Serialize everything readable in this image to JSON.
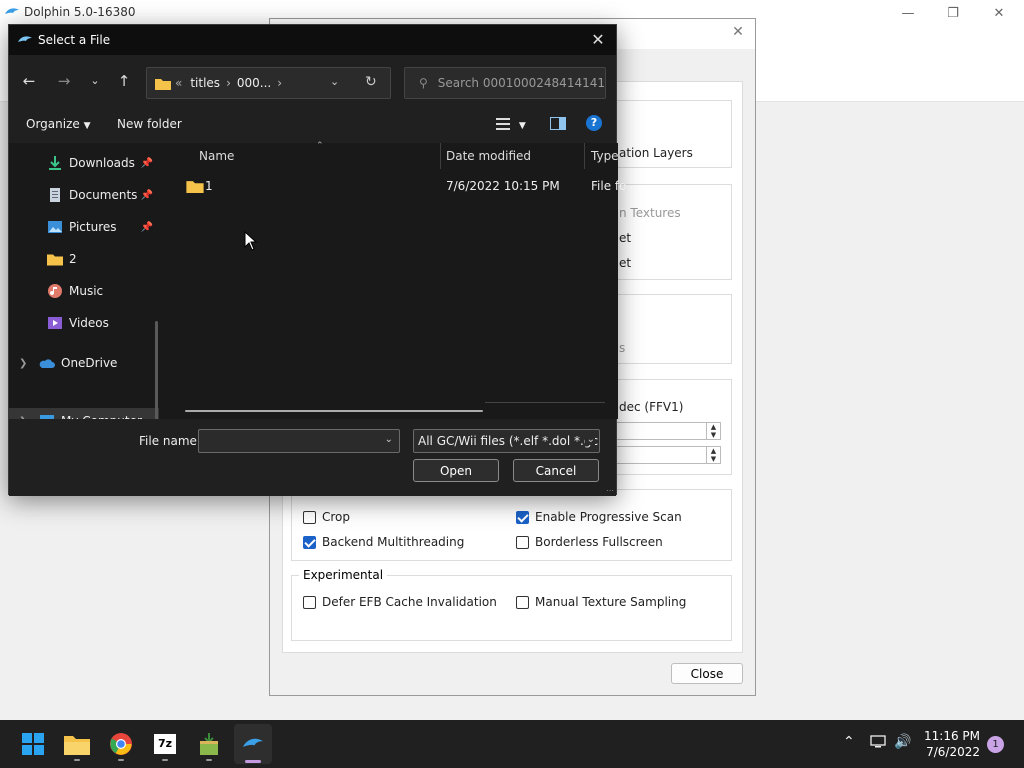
{
  "main_window": {
    "title": "Dolphin 5.0-16380"
  },
  "graphics_dialog": {
    "peek_texts": {
      "validation_layers": "ation Layers",
      "textures": "n Textures",
      "et1": "et",
      "et2": "et",
      "s": "s",
      "codec": "dec (FFV1)"
    },
    "checkboxes": {
      "crop": {
        "label": "Crop",
        "checked": false
      },
      "progressive_scan": {
        "label": "Enable Progressive Scan",
        "checked": true
      },
      "backend_multithreading": {
        "label": "Backend Multithreading",
        "checked": true
      },
      "borderless_fullscreen": {
        "label": "Borderless Fullscreen",
        "checked": false
      },
      "defer_efb": {
        "label": "Defer EFB Cache Invalidation",
        "checked": false
      },
      "manual_texture": {
        "label": "Manual Texture Sampling",
        "checked": false
      }
    },
    "experimental_title": "Experimental",
    "close_label": "Close"
  },
  "file_dialog": {
    "title": "Select a File",
    "address": {
      "overflow": "«",
      "crumb1": "titles",
      "crumb2": "000...",
      "sep": "›"
    },
    "search_placeholder": "Search 0001000248414141",
    "organize_label": "Organize",
    "new_folder_label": "New folder",
    "sidebar": [
      {
        "label": "Downloads",
        "pinned": true
      },
      {
        "label": "Documents",
        "pinned": true
      },
      {
        "label": "Pictures",
        "pinned": true
      },
      {
        "label": "2",
        "pinned": false
      },
      {
        "label": "Music",
        "pinned": false
      },
      {
        "label": "Videos",
        "pinned": false
      },
      {
        "label": "OneDrive",
        "pinned": false
      },
      {
        "label": "My Computer",
        "pinned": false,
        "selected": true
      }
    ],
    "columns": {
      "name": "Name",
      "date_modified": "Date modified",
      "type": "Type"
    },
    "files": [
      {
        "name": "1",
        "date_modified": "7/6/2022 10:15 PM",
        "type": "File fo"
      }
    ],
    "file_name_label": "File name:",
    "file_name_value": "",
    "file_type_value": "All GC/Wii files (*.elf *.dol *.gcm",
    "open_label": "Open",
    "cancel_label": "Cancel"
  },
  "taskbar": {
    "clock_time": "11:16 PM",
    "clock_date": "7/6/2022",
    "notification_count": "1"
  },
  "colors": {
    "accent": "#1a62c8",
    "dialog_bg": "#191919",
    "taskbar_bg": "#202020"
  }
}
